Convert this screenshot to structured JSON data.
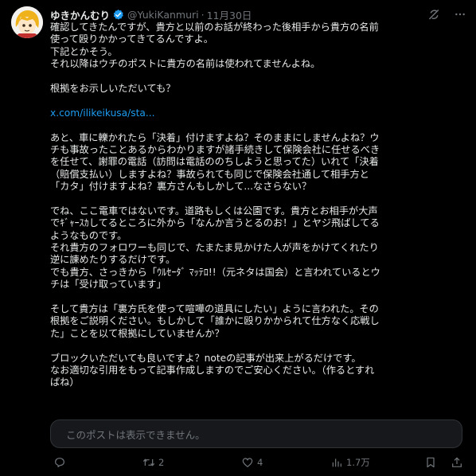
{
  "post": {
    "author_name": "ゆきかんむり",
    "handle": "@YukiKanmuri",
    "separator": "·",
    "date": "11月30日",
    "lines": [
      "確認してきたんですが、貴方と以前のお話が終わった後相手から貴方の名前",
      "使って殴りかかってきてるんですよ。",
      "下記とかそう。",
      "それ以降はウチのポストに貴方の名前は使われてませんよね。",
      "",
      "根拠をお示しいただいても？",
      "",
      "x.com/ilikeikusa/sta...",
      "",
      "あと、車に轢かれたら「決着」付けますよね？そのままにしませんよね？ウ",
      "チも事故ったことあるからわかりますが諸手続きして保険会社に任せるべき",
      "を任せて、謝罪の電話（訪問は電話ののちしようと思ってた）いれて「決着",
      "（賠償支払い）しますよね？事故られても同じで保険会社通して相手方と",
      "「カタ」付けますよね？裏方さんもしかして...なさらない？",
      "",
      "でね、ここ電車ではないです。道路もしくは公園です。貴方とお相手が大声",
      "でｷﾞｬｰｽｶしてるところに外から「なんか言うとるのお！」とヤジ飛ばしてる",
      "ようなものです。",
      "それ貴方のフォロワーも同じで、たまたま見かけた人が声をかけてくれたり",
      "逆に諌めたりするだけです。",
      "でも貴方、さっきから「ｳﾙｾｰﾀﾞ ﾏｯﾃﾛ!!（元ネタは国会）と言われているとウ",
      "チは「受け取っています」",
      "",
      "そして貴方は「裏方氏を使って喧嘩の道具にしたい」ように言われた。その",
      "根拠をご説明ください。もしかして「誰かに殴りかかられて仕方なく応戦し",
      "た」ことを以て根拠にしていませんか？",
      "",
      "ブロックいただいても良いですよ？noteの記事が出来上がるだけです。",
      "なお適切な引用をもって記事作成しますのでご安心ください。（作るとすれ",
      "ばね）"
    ],
    "link_line_index": 7,
    "quote_text": "このポストは表示できません。",
    "retweets": "2",
    "likes": "4",
    "views": "1.7万"
  },
  "colors": {
    "background": "#000000",
    "text": "#e7e9ea",
    "muted": "#71767b",
    "link": "#1d9bf0",
    "verified": "#1d9bf0",
    "quote_bg": "#16181c"
  },
  "icons": {
    "header": [
      "verified-badge-icon",
      "grok-icon",
      "more-icon"
    ],
    "actions": [
      "reply-icon",
      "retweet-icon",
      "like-icon",
      "views-icon",
      "bookmark-icon",
      "share-icon"
    ]
  }
}
